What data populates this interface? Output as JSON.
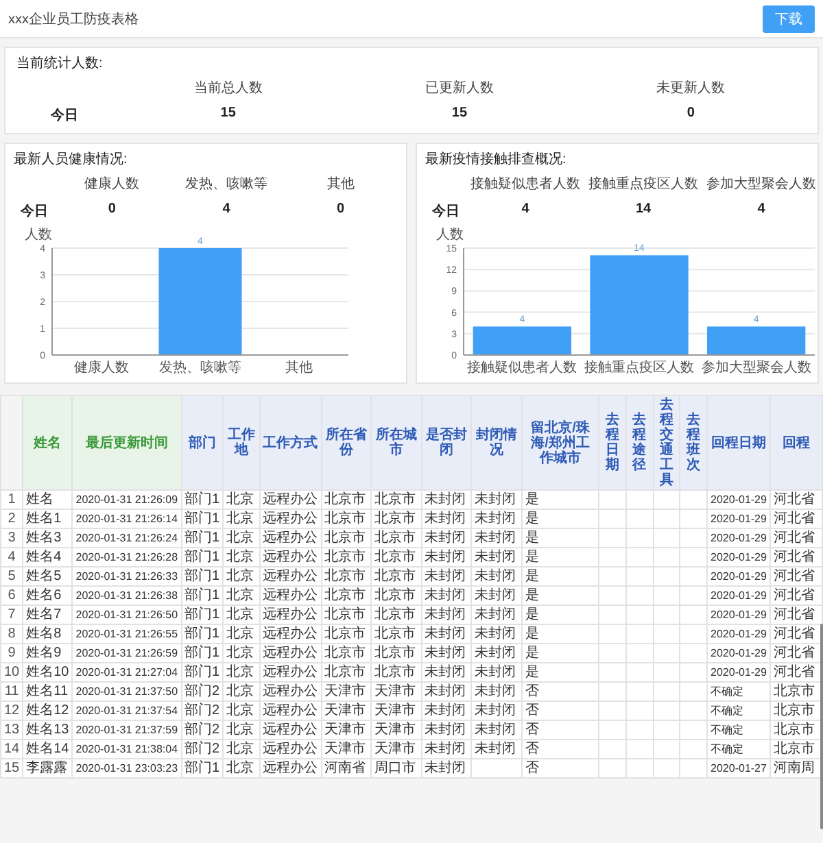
{
  "header": {
    "title": "xxx企业员工防疫表格",
    "download_button": "下载"
  },
  "summary": {
    "title": "当前统计人数:",
    "columns": [
      "当前总人数",
      "已更新人数",
      "未更新人数"
    ],
    "row_label": "今日",
    "values": [
      "15",
      "15",
      "0"
    ]
  },
  "health": {
    "title": "最新人员健康情况:",
    "columns": [
      "健康人数",
      "发热、咳嗽等",
      "其他"
    ],
    "row_label": "今日",
    "values": [
      "0",
      "4",
      "0"
    ],
    "chart_data": {
      "type": "bar",
      "ylabel": "人数",
      "categories": [
        "健康人数",
        "发热、咳嗽等",
        "其他"
      ],
      "series": [
        {
          "color": "#3fa0f5",
          "values": [
            0,
            4,
            0
          ]
        }
      ],
      "ylim": [
        0,
        4
      ],
      "yticks": [
        0,
        1,
        2,
        3,
        4
      ],
      "grid": true,
      "value_labels": [
        null,
        "4",
        null
      ]
    }
  },
  "contact": {
    "title": "最新疫情接触排查概况:",
    "columns": [
      "接触疑似患者人数",
      "接触重点疫区人数",
      "参加大型聚会人数"
    ],
    "row_label": "今日",
    "values": [
      "4",
      "14",
      "4"
    ],
    "chart_data": {
      "type": "bar",
      "ylabel": "人数",
      "categories": [
        "接触疑似患者人数",
        "接触重点疫区人数",
        "参加大型聚会人数"
      ],
      "series": [
        {
          "color": "#3fa0f5",
          "values": [
            4,
            14,
            4
          ]
        }
      ],
      "ylim": [
        0,
        15
      ],
      "yticks": [
        0,
        3,
        6,
        9,
        12,
        15
      ],
      "grid": true,
      "value_labels": [
        "4",
        "14",
        "4"
      ]
    }
  },
  "table": {
    "columns": [
      {
        "kind": "index"
      },
      {
        "label": "姓名",
        "color": "#3a9a3a"
      },
      {
        "label": "最后更新时间",
        "color": "#3a9a3a"
      },
      {
        "label": "部门",
        "color": "#2f5bb7"
      },
      {
        "label": "工作地",
        "color": "#2f5bb7"
      },
      {
        "label": "工作方式",
        "color": "#2f5bb7"
      },
      {
        "label": "所在省份",
        "color": "#2f5bb7"
      },
      {
        "label": "所在城市",
        "color": "#2f5bb7"
      },
      {
        "label": "是否封闭",
        "color": "#2f5bb7"
      },
      {
        "label": "封闭情况",
        "color": "#2f5bb7"
      },
      {
        "label": "留北京/珠海/郑州工作城市",
        "color": "#2f5bb7"
      },
      {
        "label": "去程日期",
        "color": "#2f5bb7"
      },
      {
        "label": "去程途径",
        "color": "#2f5bb7"
      },
      {
        "label": "去程交通工具",
        "color": "#2f5bb7"
      },
      {
        "label": "去程班次",
        "color": "#2f5bb7"
      },
      {
        "label": "回程日期",
        "color": "#2f5bb7"
      },
      {
        "label": "回程",
        "color": "#2f5bb7"
      }
    ],
    "rows": [
      [
        "1",
        "姓名",
        "2020-01-31 21:26:09",
        "部门1",
        "北京",
        "远程办公",
        "北京市",
        "北京市",
        "未封闭",
        "未封闭",
        "是",
        null,
        null,
        null,
        null,
        "2020-01-29",
        "河北省"
      ],
      [
        "2",
        "姓名1",
        "2020-01-31 21:26:14",
        "部门1",
        "北京",
        "远程办公",
        "北京市",
        "北京市",
        "未封闭",
        "未封闭",
        "是",
        null,
        null,
        null,
        null,
        "2020-01-29",
        "河北省"
      ],
      [
        "3",
        "姓名3",
        "2020-01-31 21:26:24",
        "部门1",
        "北京",
        "远程办公",
        "北京市",
        "北京市",
        "未封闭",
        "未封闭",
        "是",
        null,
        null,
        null,
        null,
        "2020-01-29",
        "河北省"
      ],
      [
        "4",
        "姓名4",
        "2020-01-31 21:26:28",
        "部门1",
        "北京",
        "远程办公",
        "北京市",
        "北京市",
        "未封闭",
        "未封闭",
        "是",
        null,
        null,
        null,
        null,
        "2020-01-29",
        "河北省"
      ],
      [
        "5",
        "姓名5",
        "2020-01-31 21:26:33",
        "部门1",
        "北京",
        "远程办公",
        "北京市",
        "北京市",
        "未封闭",
        "未封闭",
        "是",
        null,
        null,
        null,
        null,
        "2020-01-29",
        "河北省"
      ],
      [
        "6",
        "姓名6",
        "2020-01-31 21:26:38",
        "部门1",
        "北京",
        "远程办公",
        "北京市",
        "北京市",
        "未封闭",
        "未封闭",
        "是",
        null,
        null,
        null,
        null,
        "2020-01-29",
        "河北省"
      ],
      [
        "7",
        "姓名7",
        "2020-01-31 21:26:50",
        "部门1",
        "北京",
        "远程办公",
        "北京市",
        "北京市",
        "未封闭",
        "未封闭",
        "是",
        null,
        null,
        null,
        null,
        "2020-01-29",
        "河北省"
      ],
      [
        "8",
        "姓名8",
        "2020-01-31 21:26:55",
        "部门1",
        "北京",
        "远程办公",
        "北京市",
        "北京市",
        "未封闭",
        "未封闭",
        "是",
        null,
        null,
        null,
        null,
        "2020-01-29",
        "河北省"
      ],
      [
        "9",
        "姓名9",
        "2020-01-31 21:26:59",
        "部门1",
        "北京",
        "远程办公",
        "北京市",
        "北京市",
        "未封闭",
        "未封闭",
        "是",
        null,
        null,
        null,
        null,
        "2020-01-29",
        "河北省"
      ],
      [
        "10",
        "姓名10",
        "2020-01-31 21:27:04",
        "部门1",
        "北京",
        "远程办公",
        "北京市",
        "北京市",
        "未封闭",
        "未封闭",
        "是",
        null,
        null,
        null,
        null,
        "2020-01-29",
        "河北省"
      ],
      [
        "11",
        "姓名11",
        "2020-01-31 21:37:50",
        "部门2",
        "北京",
        "远程办公",
        "天津市",
        "天津市",
        "未封闭",
        "未封闭",
        "否",
        null,
        null,
        null,
        null,
        "不确定",
        "北京市"
      ],
      [
        "12",
        "姓名12",
        "2020-01-31 21:37:54",
        "部门2",
        "北京",
        "远程办公",
        "天津市",
        "天津市",
        "未封闭",
        "未封闭",
        "否",
        null,
        null,
        null,
        null,
        "不确定",
        "北京市"
      ],
      [
        "13",
        "姓名13",
        "2020-01-31 21:37:59",
        "部门2",
        "北京",
        "远程办公",
        "天津市",
        "天津市",
        "未封闭",
        "未封闭",
        "否",
        null,
        null,
        null,
        null,
        "不确定",
        "北京市"
      ],
      [
        "14",
        "姓名14",
        "2020-01-31 21:38:04",
        "部门2",
        "北京",
        "远程办公",
        "天津市",
        "天津市",
        "未封闭",
        "未封闭",
        "否",
        null,
        null,
        null,
        null,
        "不确定",
        "北京市"
      ],
      [
        "15",
        "李露露",
        "2020-01-31 23:03:23",
        "部门1",
        "北京",
        "远程办公",
        "河南省",
        "周口市",
        "未封闭",
        null,
        "否",
        null,
        null,
        null,
        null,
        "2020-01-27",
        "河南周"
      ]
    ]
  }
}
